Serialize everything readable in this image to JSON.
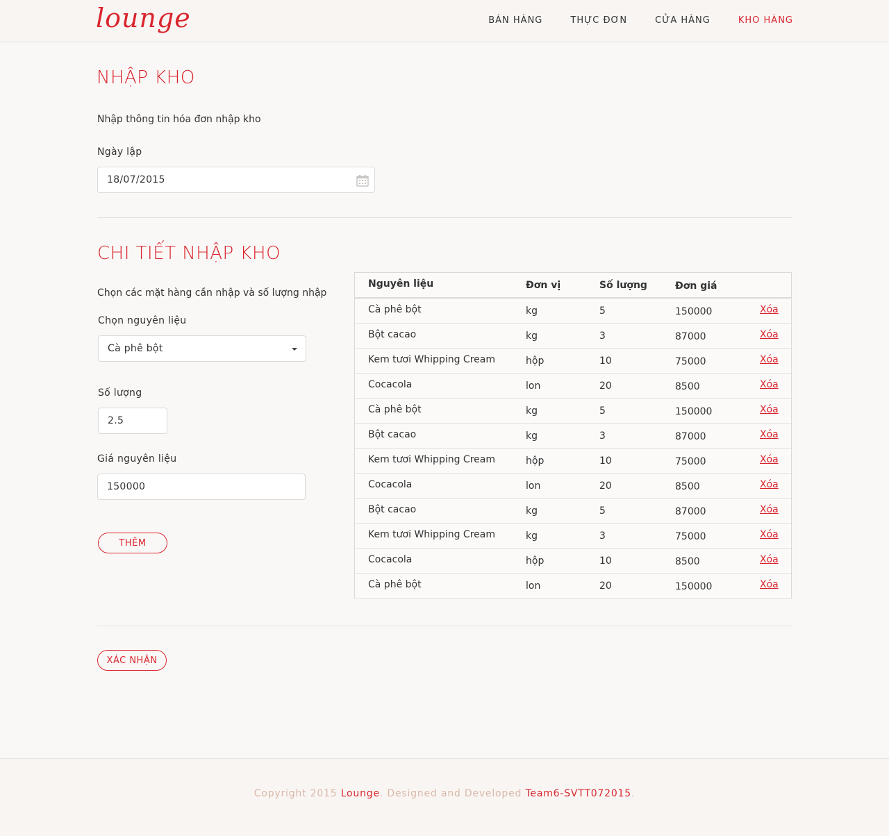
{
  "brand": "lounge",
  "nav": [
    {
      "label": "BÁN HÀNG",
      "active": false
    },
    {
      "label": "THỰC ĐƠN",
      "active": false
    },
    {
      "label": "CỬA HÀNG",
      "active": false
    },
    {
      "label": "KHO HÀNG",
      "active": true
    }
  ],
  "section1": {
    "title": "NHẬP KHO",
    "description": "Nhập thông tin hóa đơn nhập kho",
    "date_label": "Ngày lập",
    "date_value": "18/07/2015"
  },
  "section2": {
    "title": "CHI TIẾT NHẬP KHO",
    "description": "Chọn các mặt hàng cần nhập và số lượng nhập",
    "ingredient_label": "Chọn nguyên liệu",
    "ingredient_value": "Cà phê bột",
    "quantity_label": "Số lượng",
    "quantity_value": "2.5",
    "price_label": "Giá nguyên liệu",
    "price_value": "150000",
    "add_button": "THÊM"
  },
  "table": {
    "headers": [
      "Nguyên liệu",
      "Đơn vị",
      "Số lượng",
      "Đơn giá"
    ],
    "delete_label": "Xóa",
    "rows": [
      [
        "Cà phê bột",
        "kg",
        "5",
        "150000"
      ],
      [
        "Bột cacao",
        "kg",
        "3",
        "87000"
      ],
      [
        "Kem tươi Whipping Cream",
        "hộp",
        "10",
        "75000"
      ],
      [
        "Cocacola",
        "lon",
        "20",
        "8500"
      ],
      [
        "Cà phê bột",
        "kg",
        "5",
        "150000"
      ],
      [
        "Bột cacao",
        "kg",
        "3",
        "87000"
      ],
      [
        "Kem tươi Whipping Cream",
        "hộp",
        "10",
        "75000"
      ],
      [
        "Cocacola",
        "lon",
        "20",
        "8500"
      ],
      [
        "Bột cacao",
        "kg",
        "5",
        "87000"
      ],
      [
        "Kem tươi Whipping Cream",
        "kg",
        "3",
        "75000"
      ],
      [
        "Cocacola",
        "hộp",
        "10",
        "8500"
      ],
      [
        "Cà phê bột",
        "lon",
        "20",
        "150000"
      ]
    ]
  },
  "confirm_button": "XÁC NHẬN",
  "footer": {
    "prefix": "Copyright 2015 ",
    "brand": "Lounge",
    "middle": ". Designed and Developed ",
    "team": "Team6-SVTT072015",
    "suffix": "."
  },
  "colors": {
    "accent": "#d9252e",
    "background": "#faf8f6"
  },
  "icons": {
    "date": "calendar-icon",
    "select": "chevron-down-icon"
  }
}
